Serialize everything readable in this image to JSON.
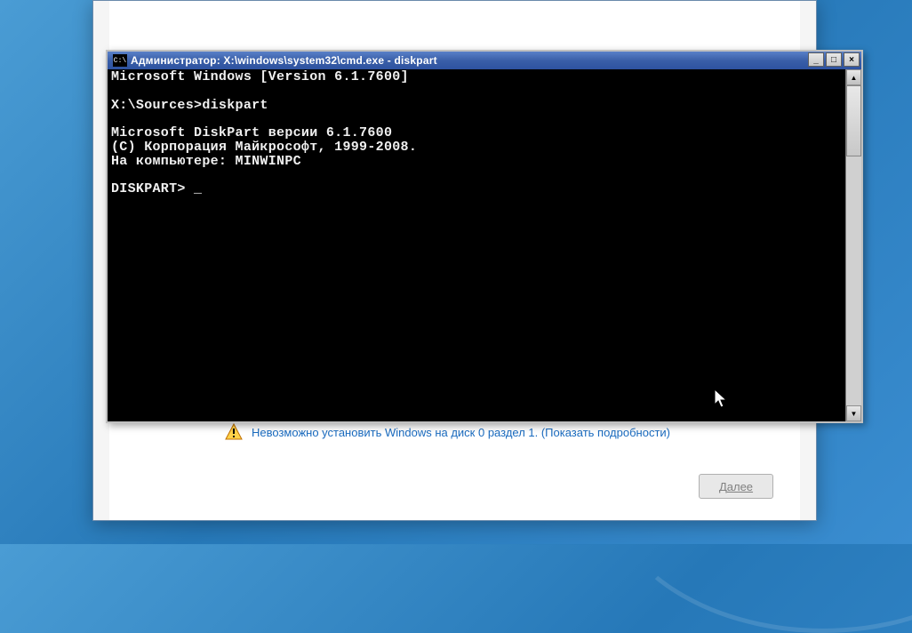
{
  "installer": {
    "warning_text": "Невозможно установить Windows на диск 0 раздел 1. (Показать подробности)",
    "next_button_label": "Далее",
    "next_button_underline": "Д"
  },
  "cmd": {
    "title": "Администратор: X:\\windows\\system32\\cmd.exe - diskpart",
    "icon_glyph": "C:\\",
    "buttons": {
      "minimize": "_",
      "maximize": "□",
      "close": "×"
    },
    "lines": {
      "l0": "Microsoft Windows [Version 6.1.7600]",
      "l1": "",
      "l2": "X:\\Sources>diskpart",
      "l3": "",
      "l4": "Microsoft DiskPart версии 6.1.7600",
      "l5": "(С) Корпорация Майкрософт, 1999-2008.",
      "l6": "На компьютере: MINWINPC",
      "l7": "",
      "l8": "DISKPART> "
    },
    "cursor": "_",
    "scroll": {
      "up": "▲",
      "down": "▼"
    }
  }
}
